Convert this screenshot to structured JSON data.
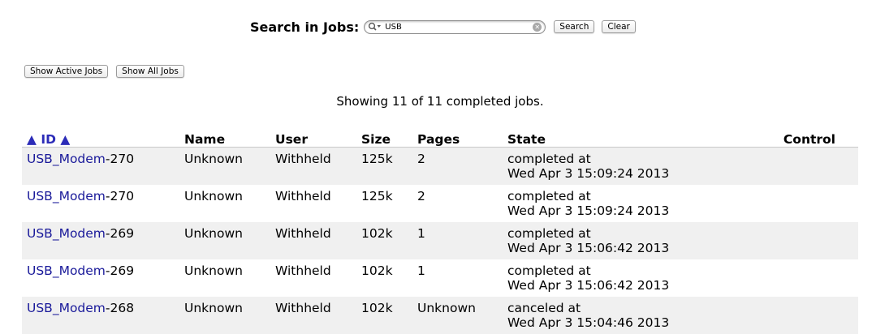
{
  "search": {
    "label": "Search in Jobs:",
    "value": "USB",
    "search_button": "Search",
    "clear_button": "Clear"
  },
  "filters": {
    "show_active": "Show Active Jobs",
    "show_all": "Show All Jobs"
  },
  "summary": "Showing 11 of 11 completed jobs.",
  "table": {
    "headers": {
      "id": "▲ ID ▲",
      "name": "Name",
      "user": "User",
      "size": "Size",
      "pages": "Pages",
      "state": "State",
      "control": "Control"
    },
    "rows": [
      {
        "printer": "USB_Modem",
        "job": "-270",
        "name": "Unknown",
        "user": "Withheld",
        "size": "125k",
        "pages": "2",
        "state": "completed at",
        "time": "Wed Apr 3 15:09:24 2013"
      },
      {
        "printer": "USB_Modem",
        "job": "-270",
        "name": "Unknown",
        "user": "Withheld",
        "size": "125k",
        "pages": "2",
        "state": "completed at",
        "time": "Wed Apr 3 15:09:24 2013"
      },
      {
        "printer": "USB_Modem",
        "job": "-269",
        "name": "Unknown",
        "user": "Withheld",
        "size": "102k",
        "pages": "1",
        "state": "completed at",
        "time": "Wed Apr 3 15:06:42 2013"
      },
      {
        "printer": "USB_Modem",
        "job": "-269",
        "name": "Unknown",
        "user": "Withheld",
        "size": "102k",
        "pages": "1",
        "state": "completed at",
        "time": "Wed Apr 3 15:06:42 2013"
      },
      {
        "printer": "USB_Modem",
        "job": "-268",
        "name": "Unknown",
        "user": "Withheld",
        "size": "102k",
        "pages": "Unknown",
        "state": "canceled at",
        "time": "Wed Apr 3 15:04:46 2013"
      }
    ]
  },
  "colors": {
    "link": "#1a1a9a",
    "row_alt": "#f0f0f0"
  }
}
